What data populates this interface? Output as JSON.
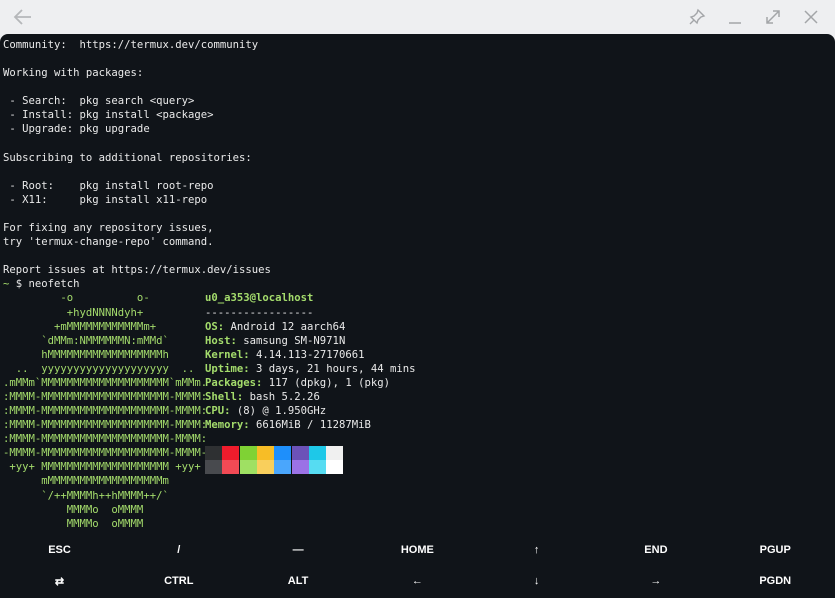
{
  "titlebar": {
    "back_icon": "arrow-left-icon",
    "pin_icon": "pin-icon",
    "minimize_icon": "minimize-icon",
    "maximize_icon": "maximize-icon",
    "close_icon": "close-icon"
  },
  "terminal": {
    "motd": [
      "Community:  https://termux.dev/community",
      "",
      "Working with packages:",
      "",
      " - Search:  pkg search <query>",
      " - Install: pkg install <package>",
      " - Upgrade: pkg upgrade",
      "",
      "Subscribing to additional repositories:",
      "",
      " - Root:    pkg install root-repo",
      " - X11:     pkg install x11-repo",
      "",
      "For fixing any repository issues,",
      "try 'termux-change-repo' command.",
      "",
      "Report issues at https://termux.dev/issues"
    ],
    "prompt_symbol": "~",
    "prompt_command": " $ neofetch",
    "logo": [
      "         -o          o-",
      "          +hydNNNNdyh+",
      "        +mMMMMMMMMMMMMm+",
      "      `dMMm:NMMMMMMN:mMMd`",
      "      hMMMMMMMMMMMMMMMMMMh",
      "  ..  yyyyyyyyyyyyyyyyyyyy  ..",
      ".mMMm`MMMMMMMMMMMMMMMMMMMM`mMMm.",
      ":MMMM-MMMMMMMMMMMMMMMMMMMM-MMMM:",
      ":MMMM-MMMMMMMMMMMMMMMMMMMM-MMMM:",
      ":MMMM-MMMMMMMMMMMMMMMMMMMM-MMMM:",
      ":MMMM-MMMMMMMMMMMMMMMMMMMM-MMMM:",
      "-MMMM-MMMMMMMMMMMMMMMMMMMM-MMMM-",
      " +yy+ MMMMMMMMMMMMMMMMMMMM +yy+",
      "      mMMMMMMMMMMMMMMMMMMm",
      "      `/++MMMMh++hMMMM++/`",
      "          MMMMo  oMMMM",
      "          MMMMo  oMMMM"
    ],
    "user_host": "u0_a353@localhost",
    "separator": "-----------------",
    "info": [
      {
        "key": "OS:",
        "value": " Android 12 aarch64"
      },
      {
        "key": "Host:",
        "value": " samsung SM-N971N"
      },
      {
        "key": "Kernel:",
        "value": " 4.14.113-27170661"
      },
      {
        "key": "Uptime:",
        "value": " 3 days, 21 hours, 44 mins"
      },
      {
        "key": "Packages:",
        "value": " 117 (dpkg), 1 (pkg)"
      },
      {
        "key": "Shell:",
        "value": " bash 5.2.26"
      },
      {
        "key": "CPU:",
        "value": " (8) @ 1.950GHz"
      },
      {
        "key": "Memory:",
        "value": " 6616MiB / 11287MiB"
      }
    ],
    "palette_top": [
      "#2e3032",
      "#ef1c2c",
      "#7fd234",
      "#f7bd26",
      "#1e8ffb",
      "#6c52b8",
      "#1ec8e8",
      "#f0f0f0"
    ],
    "palette_bottom": [
      "#484a4e",
      "#f24a55",
      "#9fe063",
      "#f9cf5c",
      "#4aa6fc",
      "#9b72e6",
      "#56dcf2",
      "#ffffff"
    ]
  },
  "extra_keys": {
    "row1": [
      "ESC",
      "/",
      "―",
      "HOME",
      "↑",
      "END",
      "PGUP"
    ],
    "row2": [
      "⇄",
      "CTRL",
      "ALT",
      "←",
      "↓",
      "→",
      "PGDN"
    ]
  }
}
